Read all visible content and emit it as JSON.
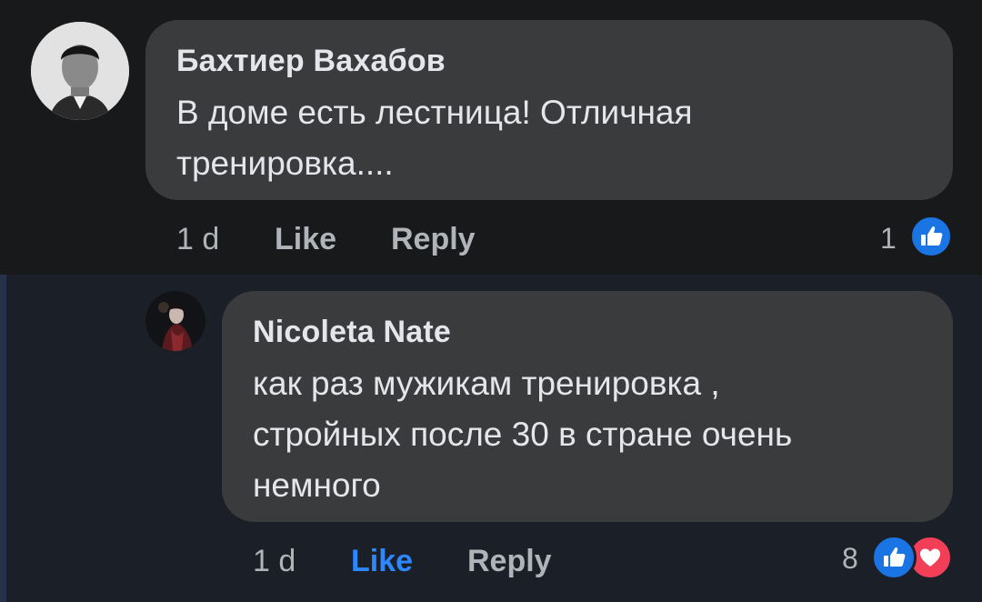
{
  "comments": [
    {
      "author": "Бахтиер Вахабов",
      "text_lines": [
        "В доме есть лестница! Отличная",
        "тренировка...."
      ],
      "time": "1 d",
      "like_label": "Like",
      "reply_label": "Reply",
      "reaction_count": "1",
      "reactions": [
        "like-reaction-icon"
      ],
      "liked_by_viewer": false
    },
    {
      "author": "Nicoleta Nate",
      "text_lines": [
        "как раз мужикам тренировка ,",
        "стройных после 30 в стране очень",
        "немного"
      ],
      "time": "1 d",
      "like_label": "Like",
      "reply_label": "Reply",
      "reaction_count": "8",
      "reactions": [
        "like-reaction-icon",
        "love-reaction-icon"
      ],
      "liked_by_viewer": true
    }
  ],
  "colors": {
    "background": "#18191a",
    "reply_background": "#1b2028",
    "bubble": "#3a3b3c",
    "text": "#e4e6eb",
    "meta_text": "#b0b3b8",
    "like_active": "#2d88ff",
    "love": "#f33e58"
  }
}
